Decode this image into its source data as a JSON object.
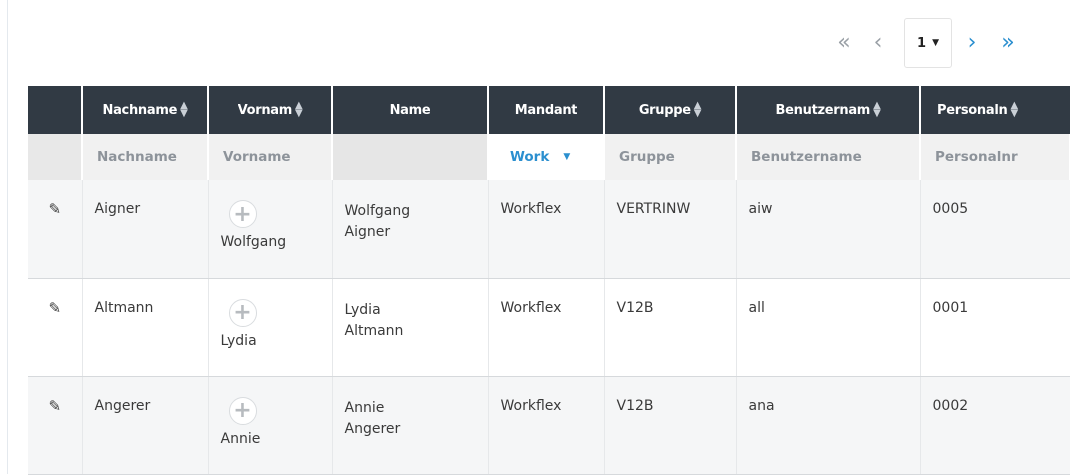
{
  "pager": {
    "first_icon": "double-chevron-left-icon",
    "prev_icon": "chevron-left-icon",
    "page_value": "1",
    "next_icon": "chevron-right-icon",
    "last_icon": "double-chevron-right-icon"
  },
  "table": {
    "headers": [
      {
        "label": "Nachname",
        "sortable": true
      },
      {
        "label": "Vornam",
        "sortable": true
      },
      {
        "label": "Name",
        "sortable": false
      },
      {
        "label": "Mandant",
        "sortable": false
      },
      {
        "label": "Gruppe",
        "sortable": true
      },
      {
        "label": "Benutzernam",
        "sortable": true
      },
      {
        "label": "Personaln",
        "sortable": true
      }
    ],
    "filters": {
      "nachname": "Nachname",
      "vorname": "Vorname",
      "mandant": "Work",
      "gruppe": "Gruppe",
      "benutzername": "Benutzername",
      "personalnr": "Personalnr"
    },
    "rows": [
      {
        "nachname": "Aigner",
        "vorname": "Wolfgang",
        "name_first": "Wolfgang",
        "name_last": "Aigner",
        "mandant": "Workflex",
        "gruppe": "VERTRINW",
        "benutzername": "aiw",
        "personalnr": "0005"
      },
      {
        "nachname": "Altmann",
        "vorname": "Lydia",
        "name_first": "Lydia",
        "name_last": "Altmann",
        "mandant": "Workflex",
        "gruppe": "V12B",
        "benutzername": "all",
        "personalnr": "0001"
      },
      {
        "nachname": "Angerer",
        "vorname": "Annie",
        "name_first": "Annie",
        "name_last": "Angerer",
        "mandant": "Workflex",
        "gruppe": "V12B",
        "benutzername": "ana",
        "personalnr": "0002"
      }
    ]
  },
  "colors": {
    "header_bg": "#313a44",
    "accent": "#2b8fcf",
    "filter_bg": "#f1f1f1"
  }
}
